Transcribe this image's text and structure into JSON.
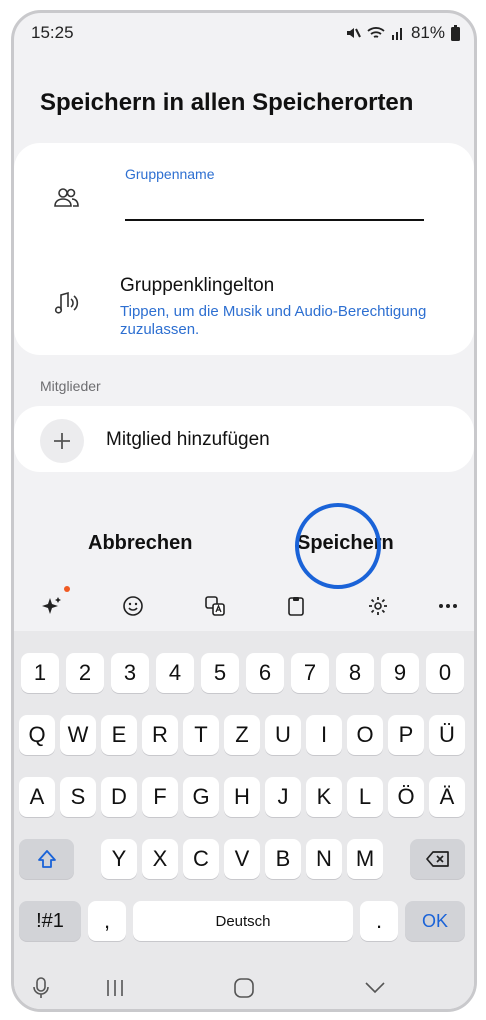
{
  "status": {
    "time": "15:25",
    "battery": "81%"
  },
  "title": "Speichern in allen Speicherorten",
  "group_name": {
    "label": "Gruppenname",
    "value": ""
  },
  "ringtone": {
    "title": "Gruppenklingelton",
    "description": "Tippen, um die Musik und Audio-Berechtigung zuzulassen."
  },
  "members": {
    "label": "Mitglieder",
    "add_label": "Mitglied hinzufügen"
  },
  "actions": {
    "cancel": "Abbrechen",
    "save": "Speichern"
  },
  "keyboard": {
    "row_numbers": [
      "1",
      "2",
      "3",
      "4",
      "5",
      "6",
      "7",
      "8",
      "9",
      "0"
    ],
    "row_q": [
      "Q",
      "W",
      "E",
      "R",
      "T",
      "Z",
      "U",
      "I",
      "O",
      "P",
      "Ü"
    ],
    "row_a": [
      "A",
      "S",
      "D",
      "F",
      "G",
      "H",
      "J",
      "K",
      "L",
      "Ö",
      "Ä"
    ],
    "row_y": [
      "Y",
      "X",
      "C",
      "V",
      "B",
      "N",
      "M"
    ],
    "symbols_key": "!#1",
    "comma_key": ",",
    "space_label": "Deutsch",
    "period_key": ".",
    "ok_key": "OK"
  },
  "colors": {
    "accent_blue": "#2d6fd1",
    "highlight_ring": "#1a63d8",
    "notification_dot": "#f05a22"
  },
  "icons": [
    "mute-icon",
    "wifi-icon",
    "signal-icon",
    "battery-icon",
    "group-icon",
    "ringtone-icon",
    "plus-icon",
    "ai-sparkle-icon",
    "emoji-icon",
    "translate-icon",
    "clipboard-icon",
    "settings-icon",
    "more-icon",
    "shift-icon",
    "backspace-icon",
    "mic-icon",
    "recents-icon",
    "home-icon",
    "back-icon"
  ]
}
